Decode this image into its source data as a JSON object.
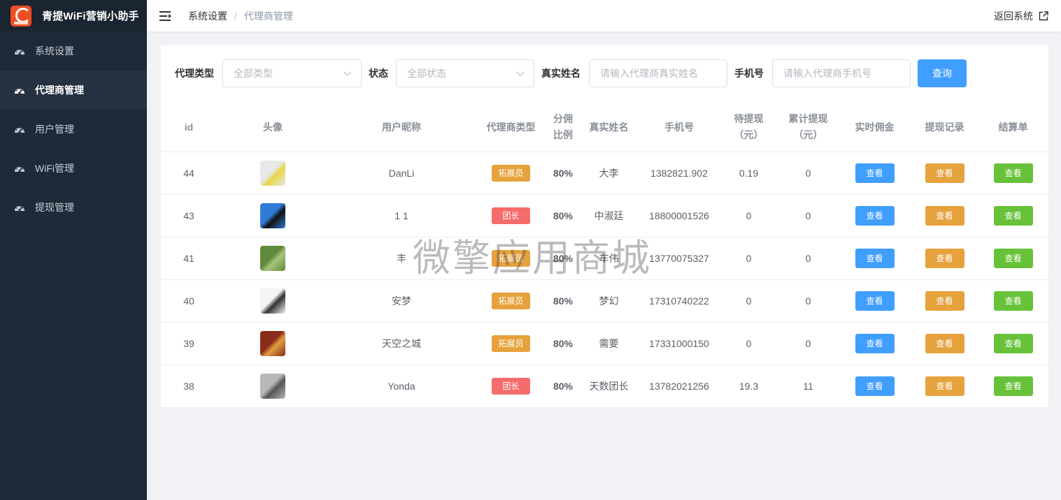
{
  "app": {
    "title": "青提WiFi营销小助手"
  },
  "sidebar": {
    "items": [
      {
        "label": "系统设置",
        "icon": "dashboard-icon",
        "active": false
      },
      {
        "label": "代理商管理",
        "icon": "dashboard-icon",
        "active": true
      },
      {
        "label": "用户管理",
        "icon": "dashboard-icon",
        "active": false
      },
      {
        "label": "WiFi管理",
        "icon": "dashboard-icon",
        "active": false
      },
      {
        "label": "提现管理",
        "icon": "dashboard-icon",
        "active": false
      }
    ]
  },
  "header": {
    "breadcrumb": [
      "系统设置",
      "代理商管理"
    ],
    "separator": "/",
    "back_label": "返回系统"
  },
  "filters": {
    "type_label": "代理类型",
    "type_placeholder": "全部类型",
    "status_label": "状态",
    "status_placeholder": "全部状态",
    "name_label": "真实姓名",
    "name_placeholder": "请输入代理商真实姓名",
    "phone_label": "手机号",
    "phone_placeholder": "请输入代理商手机号",
    "query_label": "查询"
  },
  "table": {
    "headers": {
      "id": "id",
      "avatar": "头像",
      "nickname": "用户昵称",
      "type": "代理商类型",
      "ratio_1": "分佣",
      "ratio_2": "比例",
      "realname": "真实姓名",
      "phone": "手机号",
      "pending_1": "待提现",
      "pending_2": "（元）",
      "total_1": "累计提现",
      "total_2": "（元）",
      "commission": "实时佣金",
      "withdraw": "提现记录",
      "settlement": "结算单"
    },
    "view_label": "查看",
    "rows": [
      {
        "id": "44",
        "nickname": "DanLi",
        "type": "拓展员",
        "type_kind": "expand",
        "ratio": "80%",
        "realname": "大李",
        "phone": "1382821.902",
        "pending": "0.19",
        "total": "0",
        "avatar_color": "#e8e8e8",
        "avatar_accent": "#e8d64a"
      },
      {
        "id": "43",
        "nickname": "1 1",
        "type": "团长",
        "type_kind": "leader",
        "ratio": "80%",
        "realname": "中淑廷",
        "phone": "18800001526",
        "pending": "0",
        "total": "0",
        "avatar_color": "#2f7bd6",
        "avatar_accent": "#111111"
      },
      {
        "id": "41",
        "nickname": "丰",
        "type": "拓展员",
        "type_kind": "expand",
        "ratio": "80%",
        "realname": "车伟",
        "phone": "13770075327",
        "pending": "0",
        "total": "0",
        "avatar_color": "#5f8a3a",
        "avatar_accent": "#a8c47c"
      },
      {
        "id": "40",
        "nickname": "安梦",
        "type": "拓展员",
        "type_kind": "expand",
        "ratio": "80%",
        "realname": "梦幻",
        "phone": "17310740222",
        "pending": "0",
        "total": "0",
        "avatar_color": "#f4f4f4",
        "avatar_accent": "#333333"
      },
      {
        "id": "39",
        "nickname": "天空之城",
        "type": "拓展员",
        "type_kind": "expand",
        "ratio": "80%",
        "realname": "需要",
        "phone": "17331000150",
        "pending": "0",
        "total": "0",
        "avatar_color": "#8a2a1a",
        "avatar_accent": "#e0a040"
      },
      {
        "id": "38",
        "nickname": "Yonda",
        "type": "团长",
        "type_kind": "leader",
        "ratio": "80%",
        "realname": "天数团长",
        "phone": "13782021256",
        "pending": "19.3",
        "total": "11",
        "avatar_color": "#b8b8b8",
        "avatar_accent": "#555555"
      }
    ]
  },
  "watermark": "微擎应用商城",
  "colors": {
    "sidebar_bg": "#1f2a38",
    "primary": "#409eff",
    "warning": "#e6a23c",
    "success": "#67c23a",
    "danger": "#f56c6c"
  }
}
